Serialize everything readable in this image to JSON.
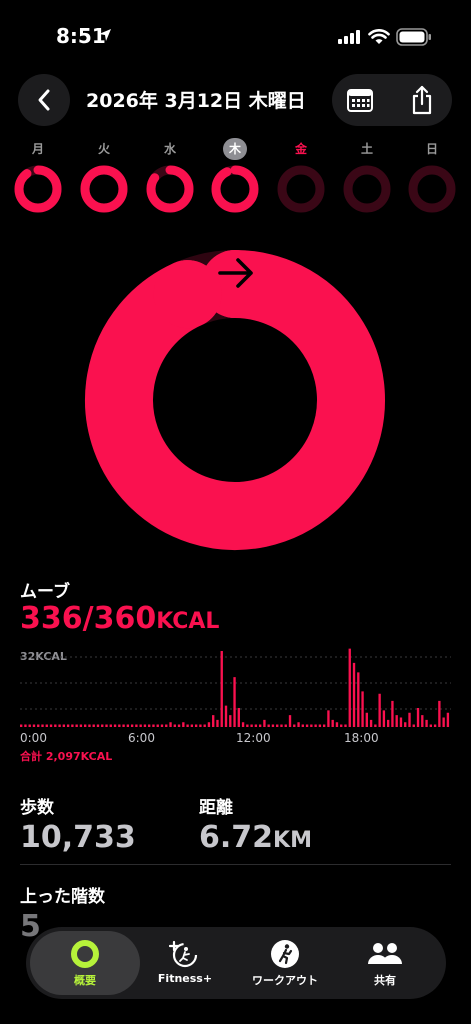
{
  "status_bar": {
    "time": "8:51"
  },
  "header": {
    "title": "2026年 3月12日 木曜日"
  },
  "week": {
    "days": [
      {
        "label": "月",
        "progress": 0.9
      },
      {
        "label": "火",
        "progress": 1.0
      },
      {
        "label": "水",
        "progress": 0.85
      },
      {
        "label": "木",
        "progress": 0.93
      },
      {
        "label": "金",
        "progress": 0.0
      },
      {
        "label": "土",
        "progress": 0.0
      },
      {
        "label": "日",
        "progress": 0.0
      }
    ],
    "today_label": "木",
    "selected_label": "金"
  },
  "move_ring": {
    "progress": 0.933
  },
  "move": {
    "label": "ムーブ",
    "value": "336/360",
    "unit": "KCAL"
  },
  "chart": {
    "ylabel": "32KCAL",
    "total": "合計 2,097KCAL",
    "ticks": [
      "0:00",
      "6:00",
      "12:00",
      "18:00"
    ]
  },
  "chart_data": {
    "type": "bar",
    "bar_count": 72,
    "ylim": [
      0,
      32
    ],
    "values": [
      1,
      1,
      1,
      1,
      1,
      1,
      1,
      1,
      1,
      1,
      1,
      1,
      1,
      1,
      1,
      1,
      1,
      1,
      1,
      1,
      1,
      1,
      1,
      1,
      1,
      1,
      1,
      1,
      1,
      1,
      1,
      1,
      1,
      1,
      1,
      2,
      1,
      1,
      2,
      1,
      1,
      1,
      1,
      1,
      2,
      5,
      3,
      32,
      9,
      5,
      21,
      8,
      2,
      1,
      1,
      1,
      1,
      3,
      1,
      1,
      1,
      1,
      1,
      5,
      1,
      2,
      1,
      1,
      1,
      1,
      1,
      1,
      7,
      3,
      2,
      1,
      1,
      33,
      27,
      23,
      15,
      6,
      3,
      1,
      14,
      7,
      3,
      11,
      5,
      4,
      2,
      6,
      1,
      8,
      5,
      3,
      1,
      1,
      11,
      4,
      6
    ],
    "series_color": "#fa114f",
    "grid": true
  },
  "stats": {
    "steps": {
      "label": "歩数",
      "value": "10,733"
    },
    "distance": {
      "label": "距離",
      "value": "6.72",
      "unit": "KM"
    },
    "floors": {
      "label": "上った階数",
      "value": "5"
    }
  },
  "tabs": [
    {
      "label": "概要",
      "icon": "activity-rings-icon",
      "active": true
    },
    {
      "label": "Fitness+",
      "icon": "fitness-plus-icon",
      "active": false
    },
    {
      "label": "ワークアウト",
      "icon": "workout-runner-icon",
      "active": false
    },
    {
      "label": "共有",
      "icon": "sharing-people-icon",
      "active": false
    }
  ],
  "colors": {
    "move": "#fa114f",
    "accent_green": "#b6f23a",
    "background": "#000000"
  }
}
